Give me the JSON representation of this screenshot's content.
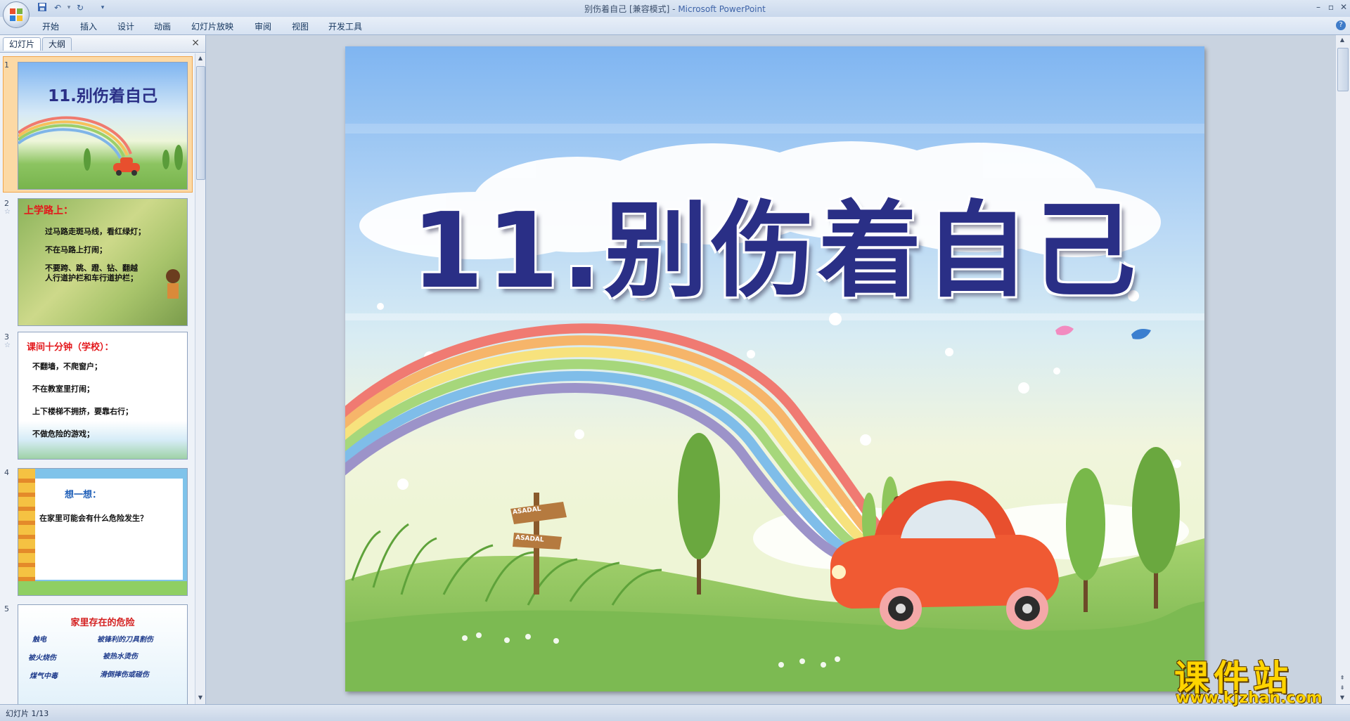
{
  "window": {
    "title": "别伤着自己 [兼容模式] - ",
    "app_name": "Microsoft PowerPoint",
    "minimize": "–",
    "restore": "▫",
    "close": "✕"
  },
  "qat": {
    "save_icon": "save-icon",
    "undo_icon": "undo-icon",
    "redo_icon": "redo-icon",
    "customize_icon": "dropdown-icon"
  },
  "ribbon": {
    "tabs": [
      "开始",
      "插入",
      "设计",
      "动画",
      "幻灯片放映",
      "审阅",
      "视图",
      "开发工具"
    ],
    "help": "?"
  },
  "pane": {
    "tab_slides": "幻灯片",
    "tab_outline": "大纲",
    "close": "×",
    "thumbs": [
      {
        "num": "1",
        "title": "11.别伤着自己"
      },
      {
        "num": "2",
        "heading": "上学路上：",
        "lines": [
          "过马路走斑马线，看红绿灯；",
          "不在马路上打闹；",
          "不要跨、跳、蹬、钻、翻越",
          "人行道护栏和车行道护栏；"
        ]
      },
      {
        "num": "3",
        "heading": "课间十分钟（学校）：",
        "lines": [
          "不翻墙，不爬窗户；",
          "不在教室里打闹；",
          "上下楼梯不拥挤，要靠右行；",
          "不做危险的游戏；"
        ]
      },
      {
        "num": "4",
        "heading": "想一想：",
        "lines": [
          "在家里可能会有什么危险发生？"
        ]
      },
      {
        "num": "5",
        "heading": "家里存在的危险",
        "lines": [
          "触电",
          "被锋利的刀具割伤",
          "被火烧伤",
          "被热水烫伤",
          "煤气中毒",
          "滑倒摔伤或碰伤"
        ]
      }
    ]
  },
  "slide": {
    "title": "11.别伤着自己",
    "sign_text": "ASADAL"
  },
  "status": {
    "text": "幻灯片 1/13"
  },
  "watermark": {
    "main": "课件站",
    "url": "www.kjzhan.com"
  },
  "colors": {
    "title_blue": "#2a2f86",
    "sky": "#7fb5f1",
    "grass": "#8cc461",
    "car": "#e84f2e",
    "ribbon_bg": "#dde7f4"
  }
}
